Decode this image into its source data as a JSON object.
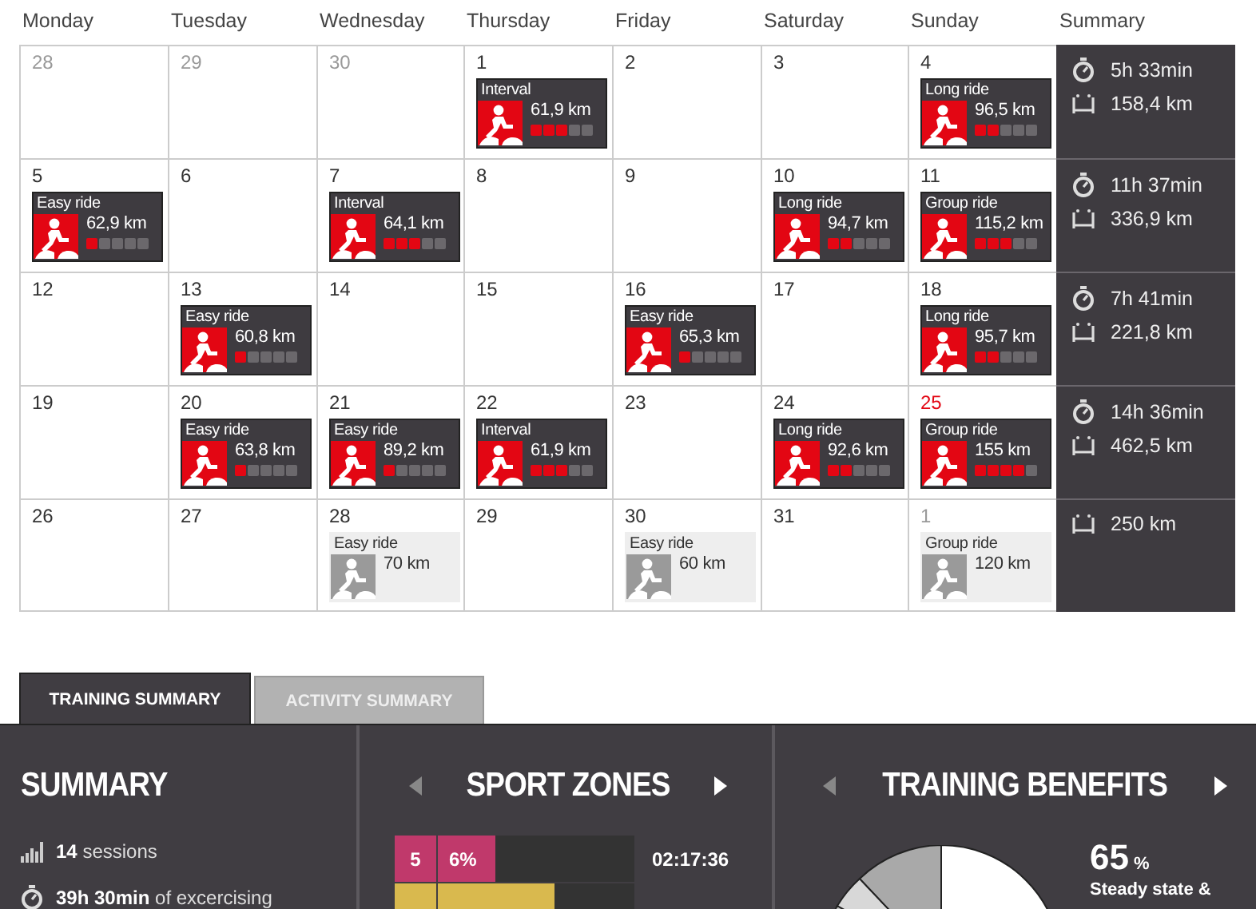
{
  "calendar": {
    "columns": [
      "Monday",
      "Tuesday",
      "Wednesday",
      "Thursday",
      "Friday",
      "Saturday",
      "Sunday",
      "Summary"
    ],
    "weeks": [
      {
        "days": [
          {
            "date": "28",
            "other_month": true,
            "today": false
          },
          {
            "date": "29",
            "other_month": true,
            "today": false
          },
          {
            "date": "30",
            "other_month": true,
            "today": false
          },
          {
            "date": "1",
            "other_month": false,
            "today": false,
            "activity": {
              "kind": "done",
              "title": "Interval",
              "distance": "61,9 km",
              "stars": 3
            }
          },
          {
            "date": "2",
            "other_month": false,
            "today": false
          },
          {
            "date": "3",
            "other_month": false,
            "today": false
          },
          {
            "date": "4",
            "other_month": false,
            "today": false,
            "activity": {
              "kind": "done",
              "title": "Long ride",
              "distance": "96,5 km",
              "stars": 2
            }
          }
        ],
        "summary": {
          "time": "5h 33min",
          "distance": "158,4 km"
        }
      },
      {
        "days": [
          {
            "date": "5",
            "other_month": false,
            "today": false,
            "activity": {
              "kind": "done",
              "title": "Easy ride",
              "distance": "62,9 km",
              "stars": 1
            }
          },
          {
            "date": "6",
            "other_month": false,
            "today": false
          },
          {
            "date": "7",
            "other_month": false,
            "today": false,
            "activity": {
              "kind": "done",
              "title": "Interval",
              "distance": "64,1 km",
              "stars": 3
            }
          },
          {
            "date": "8",
            "other_month": false,
            "today": false
          },
          {
            "date": "9",
            "other_month": false,
            "today": false
          },
          {
            "date": "10",
            "other_month": false,
            "today": false,
            "activity": {
              "kind": "done",
              "title": "Long ride",
              "distance": "94,7 km",
              "stars": 2
            }
          },
          {
            "date": "11",
            "other_month": false,
            "today": false,
            "activity": {
              "kind": "done",
              "title": "Group ride",
              "distance": "115,2 km",
              "stars": 3
            }
          }
        ],
        "summary": {
          "time": "11h 37min",
          "distance": "336,9 km"
        }
      },
      {
        "days": [
          {
            "date": "12",
            "other_month": false,
            "today": false
          },
          {
            "date": "13",
            "other_month": false,
            "today": false,
            "activity": {
              "kind": "done",
              "title": "Easy ride",
              "distance": "60,8 km",
              "stars": 1
            }
          },
          {
            "date": "14",
            "other_month": false,
            "today": false
          },
          {
            "date": "15",
            "other_month": false,
            "today": false
          },
          {
            "date": "16",
            "other_month": false,
            "today": false,
            "activity": {
              "kind": "done",
              "title": "Easy ride",
              "distance": "65,3 km",
              "stars": 1
            }
          },
          {
            "date": "17",
            "other_month": false,
            "today": false
          },
          {
            "date": "18",
            "other_month": false,
            "today": false,
            "activity": {
              "kind": "done",
              "title": "Long ride",
              "distance": "95,7 km",
              "stars": 2
            }
          }
        ],
        "summary": {
          "time": "7h 41min",
          "distance": "221,8 km"
        }
      },
      {
        "days": [
          {
            "date": "19",
            "other_month": false,
            "today": false
          },
          {
            "date": "20",
            "other_month": false,
            "today": false,
            "activity": {
              "kind": "done",
              "title": "Easy ride",
              "distance": "63,8 km",
              "stars": 1
            }
          },
          {
            "date": "21",
            "other_month": false,
            "today": false,
            "activity": {
              "kind": "done",
              "title": "Easy ride",
              "distance": "89,2 km",
              "stars": 1
            }
          },
          {
            "date": "22",
            "other_month": false,
            "today": false,
            "activity": {
              "kind": "done",
              "title": "Interval",
              "distance": "61,9 km",
              "stars": 3
            }
          },
          {
            "date": "23",
            "other_month": false,
            "today": false
          },
          {
            "date": "24",
            "other_month": false,
            "today": false,
            "activity": {
              "kind": "done",
              "title": "Long ride",
              "distance": "92,6 km",
              "stars": 2
            }
          },
          {
            "date": "25",
            "other_month": false,
            "today": true,
            "activity": {
              "kind": "done",
              "title": "Group ride",
              "distance": "155 km",
              "stars": 4
            }
          }
        ],
        "summary": {
          "time": "14h 36min",
          "distance": "462,5 km"
        }
      },
      {
        "days": [
          {
            "date": "26",
            "other_month": false,
            "today": false
          },
          {
            "date": "27",
            "other_month": false,
            "today": false
          },
          {
            "date": "28",
            "other_month": false,
            "today": false,
            "activity": {
              "kind": "planned",
              "title": "Easy ride",
              "distance": "70 km"
            }
          },
          {
            "date": "29",
            "other_month": false,
            "today": false
          },
          {
            "date": "30",
            "other_month": false,
            "today": false,
            "activity": {
              "kind": "planned",
              "title": "Easy ride",
              "distance": "60 km"
            }
          },
          {
            "date": "31",
            "other_month": false,
            "today": false
          },
          {
            "date": "1",
            "other_month": true,
            "today": false,
            "activity": {
              "kind": "planned",
              "title": "Group ride",
              "distance": "120 km"
            }
          }
        ],
        "summary": {
          "distance": "250 km"
        }
      }
    ]
  },
  "tabs": [
    {
      "label": "TRAINING SUMMARY",
      "selected": true
    },
    {
      "label": "ACTIVITY SUMMARY",
      "selected": false
    }
  ],
  "summary": {
    "title": "SUMMARY",
    "items": [
      {
        "kind": "sessions",
        "text": "**14** sessions"
      },
      {
        "kind": "time",
        "text": "**39h 30min** of excercising"
      }
    ]
  },
  "sport_zones": {
    "title": "SPORT ZONES",
    "zones": [
      {
        "zone": "5",
        "percent": "6%",
        "time": "02:17:36",
        "color": "#c0396b",
        "level": 0.29
      },
      {
        "color": "#d9b94e",
        "level": 0.59
      }
    ]
  },
  "training_benefits": {
    "title": "TRAINING BENEFITS",
    "value": "65",
    "unit": "%",
    "label": "Steady state &"
  }
}
